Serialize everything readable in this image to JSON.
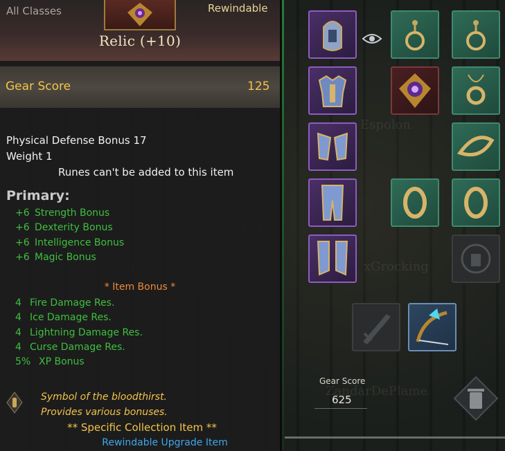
{
  "tooltip": {
    "class_label": "All Classes",
    "rewindable_label": "Rewindable",
    "item_name": "Relic (+10)",
    "gear_score_label": "Gear Score",
    "gear_score_value": "125",
    "physical_defense": "Physical Defense Bonus 17",
    "weight": "Weight 1",
    "runes_note": "Runes can't be added to this item",
    "primary_title": "Primary:",
    "primary_bonuses": [
      {
        "value": "+6",
        "label": "Strength Bonus"
      },
      {
        "value": "+6",
        "label": "Dexterity Bonus"
      },
      {
        "value": "+6",
        "label": "Intelligence Bonus"
      },
      {
        "value": "+6",
        "label": "Magic Bonus"
      }
    ],
    "item_bonus_title": "*  Item Bonus *",
    "item_bonuses": [
      {
        "value": "4",
        "label": "Fire Damage Res."
      },
      {
        "value": "4",
        "label": "Ice Damage Res."
      },
      {
        "value": "4",
        "label": "Lightning Damage Res."
      },
      {
        "value": "4",
        "label": "Curse Damage Res."
      },
      {
        "value": "5%",
        "label": "XP Bonus"
      }
    ],
    "description_lines": [
      "Symbol of the bloodthirst.",
      "Provides various bonuses."
    ],
    "collection_note": "** Specific Collection Item **",
    "upgrade_note": "Rewindable Upgrade Item"
  },
  "equipment": {
    "gear_score_label": "Gear Score",
    "gear_score_value": "625",
    "slots": [
      {
        "name": "helmet",
        "rarity": "purple"
      },
      {
        "name": "earring-left",
        "rarity": "green"
      },
      {
        "name": "earring-right",
        "rarity": "green"
      },
      {
        "name": "chest-armor",
        "rarity": "purple"
      },
      {
        "name": "relic",
        "rarity": "red"
      },
      {
        "name": "necklace",
        "rarity": "green"
      },
      {
        "name": "gloves",
        "rarity": "purple"
      },
      {
        "name": "bracelet",
        "rarity": "green"
      },
      {
        "name": "leggings",
        "rarity": "purple"
      },
      {
        "name": "ring-left",
        "rarity": "green"
      },
      {
        "name": "ring-right",
        "rarity": "green"
      },
      {
        "name": "boots",
        "rarity": "purple"
      },
      {
        "name": "locked-slot",
        "rarity": "empty"
      },
      {
        "name": "weapon-empty",
        "rarity": "empty"
      },
      {
        "name": "bow",
        "rarity": "blue"
      }
    ]
  },
  "colors": {
    "gold": "#f3c44b",
    "green_bonus": "#3fbf3f",
    "orange": "#ef8a3a",
    "blue_link": "#3fa7ef"
  }
}
